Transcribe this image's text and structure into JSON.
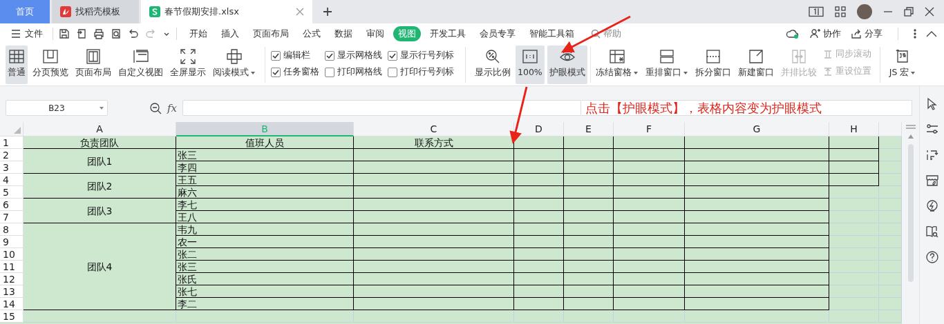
{
  "tabs": [
    {
      "label": "首页",
      "kind": "home",
      "selected": false
    },
    {
      "label": "找稻壳模板",
      "kind": "template",
      "selected": false
    },
    {
      "label": "春节假期安排.xlsx",
      "kind": "sheet",
      "selected": true
    }
  ],
  "menu": {
    "file_label": "文件",
    "tabs": [
      {
        "label": "开始",
        "selected": false
      },
      {
        "label": "插入",
        "selected": false
      },
      {
        "label": "页面布局",
        "selected": false
      },
      {
        "label": "公式",
        "selected": false
      },
      {
        "label": "数据",
        "selected": false
      },
      {
        "label": "审阅",
        "selected": false
      },
      {
        "label": "视图",
        "selected": true
      },
      {
        "label": "开发工具",
        "selected": false
      },
      {
        "label": "会员专享",
        "selected": false
      },
      {
        "label": "智能工具箱",
        "selected": false
      }
    ],
    "search_placeholder": "帮助",
    "collab_label": "协作",
    "share_label": "分享"
  },
  "ribbon": {
    "views": [
      {
        "label": "普通",
        "kind": "normal",
        "selected": true,
        "dropdown": false
      },
      {
        "label": "分页预览",
        "kind": "pagebreak",
        "selected": false,
        "dropdown": false
      },
      {
        "label": "页面布局",
        "kind": "layout",
        "selected": false,
        "dropdown": false
      },
      {
        "label": "自定义视图",
        "kind": "custom",
        "selected": false,
        "dropdown": false
      },
      {
        "label": "全屏显示",
        "kind": "fullscreen",
        "selected": false,
        "dropdown": false
      },
      {
        "label": "阅读模式",
        "kind": "reading",
        "selected": false,
        "dropdown": true
      }
    ],
    "checkboxes": [
      {
        "label": "编辑栏",
        "checked": true
      },
      {
        "label": "任务窗格",
        "checked": true
      },
      {
        "label": "显示网格线",
        "checked": true
      },
      {
        "label": "打印网格线",
        "checked": false
      },
      {
        "label": "显示行号列标",
        "checked": true
      },
      {
        "label": "打印行号列标",
        "checked": false
      }
    ],
    "view_tools": [
      {
        "label": "显示比例",
        "kind": "zoom",
        "selected": false
      },
      {
        "label": "100%",
        "kind": "actual",
        "selected": true
      },
      {
        "label": "护眼模式",
        "kind": "eye",
        "selected": true
      }
    ],
    "windows": [
      {
        "label": "冻结窗格",
        "kind": "freeze",
        "dropdown": true,
        "disabled": false
      },
      {
        "label": "重排窗口",
        "kind": "arrange",
        "dropdown": true,
        "disabled": false
      },
      {
        "label": "拆分窗口",
        "kind": "split",
        "dropdown": false,
        "disabled": false
      },
      {
        "label": "新建窗口",
        "kind": "new",
        "dropdown": false,
        "disabled": false
      },
      {
        "label": "并排比较",
        "kind": "compare",
        "dropdown": false,
        "disabled": true
      }
    ],
    "sync": [
      {
        "label": "同步滚动",
        "kind": "scroll",
        "disabled": true
      },
      {
        "label": "重设位置",
        "kind": "reset",
        "disabled": true
      }
    ],
    "macro": {
      "label": "JS 宏",
      "dropdown": true
    }
  },
  "formula_bar": {
    "name_box": "B23",
    "fx": "fx"
  },
  "annotation": {
    "text": "点击【护眼模式】，表格内容变为护眼模式"
  },
  "sheet": {
    "columns": [
      {
        "label": "A",
        "selected": false
      },
      {
        "label": "B",
        "selected": true
      },
      {
        "label": "C",
        "selected": false
      },
      {
        "label": "D",
        "selected": false
      },
      {
        "label": "E",
        "selected": false
      },
      {
        "label": "F",
        "selected": false
      },
      {
        "label": "G",
        "selected": false
      },
      {
        "label": "H",
        "selected": false
      }
    ],
    "row_numbers": [
      "1",
      "2",
      "3",
      "4",
      "5",
      "6",
      "7",
      "8",
      "9",
      "10",
      "11",
      "12",
      "13",
      "14",
      "15"
    ],
    "header_row": [
      "负责团队",
      "值班人员",
      "联系方式"
    ],
    "groups": [
      {
        "team": "团队1",
        "members": [
          "张三",
          "李四"
        ]
      },
      {
        "team": "团队2",
        "members": [
          "王五",
          "麻六"
        ]
      },
      {
        "team": "团队3",
        "members": [
          "李七",
          "王八"
        ]
      },
      {
        "team": "团队4",
        "members": [
          "韦九",
          "农一",
          "张二",
          "张三",
          "张氏",
          "张七",
          "李二"
        ]
      }
    ]
  }
}
